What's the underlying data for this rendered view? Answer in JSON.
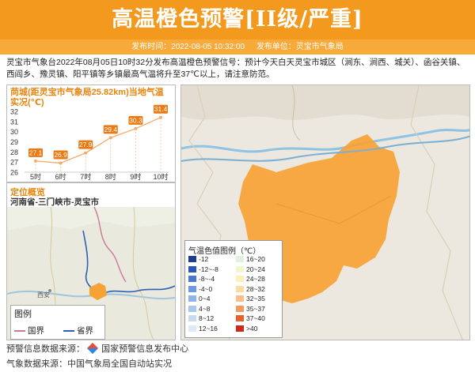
{
  "header": {
    "title": "高温橙色预警[II级/严重]",
    "publish_time": "发布时间：2022-08-05 10:32:00",
    "publish_unit": "发布单位：灵宝市气象局"
  },
  "description": "灵宝市气象台2022年08月05日10时32分发布高温橙色预警信号：预计今天白天灵宝市城区（涧东、涧西、城关）、函谷关镇、西阎乡、豫灵镇、阳平镇等乡镇最高气温将升至37℃以上，请注意防范。",
  "temp_panel": {
    "title": "苘城(距灵宝市气象局25.82km)当地气温实况(℃)"
  },
  "chart_data": {
    "type": "line",
    "title": "苘城(距灵宝市气象局25.82km)当地气温实况(℃)",
    "categories": [
      "5时",
      "6时",
      "7时",
      "8时",
      "9时",
      "10时"
    ],
    "values": [
      27.1,
      26.9,
      27.9,
      29.4,
      30.3,
      31.4
    ],
    "y_ticks": [
      "32",
      "31",
      "30",
      "29",
      "28",
      "27",
      "26"
    ],
    "ylim": [
      26,
      32
    ],
    "colors": {
      "line": "#f5a96a",
      "label": "#e97a14"
    }
  },
  "location_panel": {
    "title": "定位概览",
    "subtitle": "河南省-三门峡市-灵宝市",
    "map_labels": {
      "xian": "西安"
    },
    "legend": {
      "title": "图例",
      "items": [
        {
          "label": "国界",
          "color": "#c77a9a"
        },
        {
          "label": "省界",
          "color": "#2d5fb5"
        }
      ]
    }
  },
  "map_legend": {
    "title": "气温色值图例（℃）",
    "items": [
      {
        "label": "-12",
        "color": "#1f3c8f"
      },
      {
        "label": "-12~-8",
        "color": "#2e57b0"
      },
      {
        "label": "-8~-4",
        "color": "#4a78cc"
      },
      {
        "label": "-4~0",
        "color": "#6f9adf"
      },
      {
        "label": "0~4",
        "color": "#8fb4e8"
      },
      {
        "label": "4~8",
        "color": "#a9c8ee"
      },
      {
        "label": "8~12",
        "color": "#c7dcf3"
      },
      {
        "label": "12~16",
        "color": "#dfeaf6"
      },
      {
        "label": "16~20",
        "color": "#e3f0e1"
      },
      {
        "label": "20~24",
        "color": "#f1f7cf"
      },
      {
        "label": "24~28",
        "color": "#fbf1b8"
      },
      {
        "label": "28~32",
        "color": "#fcdba0"
      },
      {
        "label": "32~35",
        "color": "#fbc08a"
      },
      {
        "label": "35~37",
        "color": "#f59a5e"
      },
      {
        "label": "37~40",
        "color": "#e5632b"
      },
      {
        "label": ">40",
        "color": "#c92a1c"
      }
    ]
  },
  "footer": {
    "warning_source": "预警信息数据来源：",
    "warning_source_name": "国家预警信息发布中心",
    "weather_source": "气象数据来源：中国气象局全国自动站实况"
  },
  "colors": {
    "banner": "#f39a1e",
    "accent": "#e8850f",
    "warning_region": "#f7a235"
  }
}
